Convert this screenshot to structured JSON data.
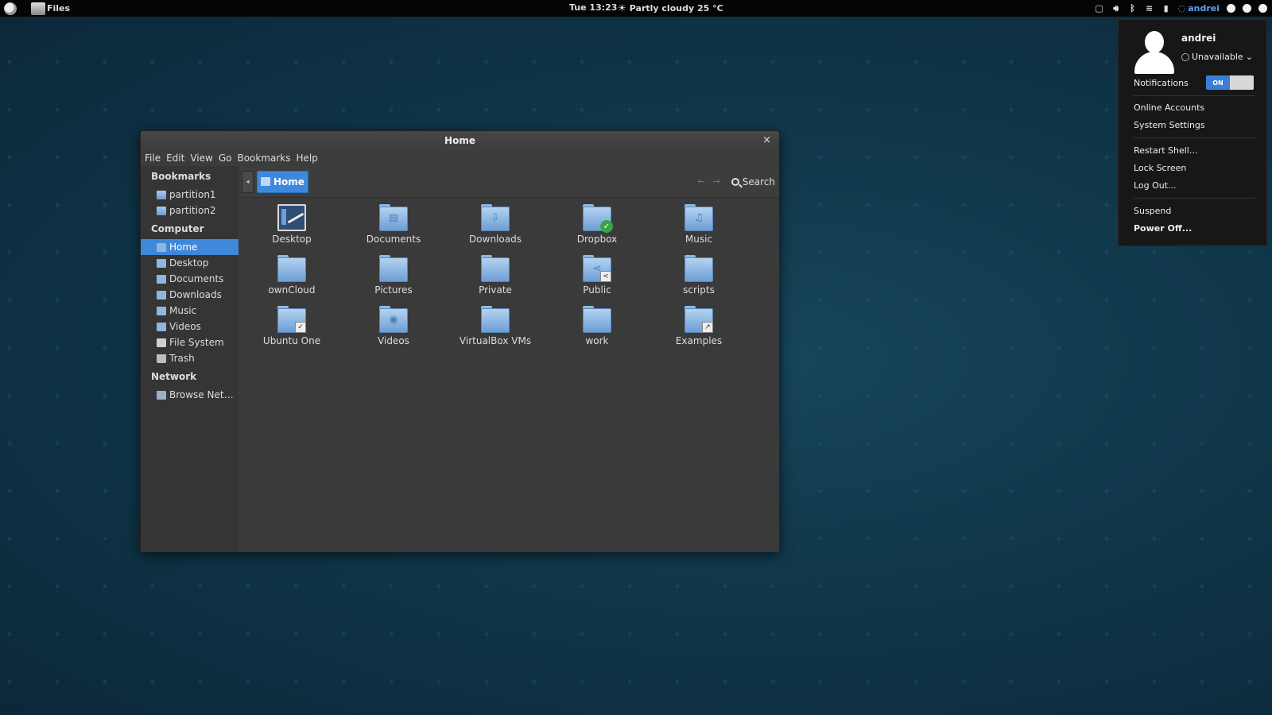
{
  "top_panel": {
    "app_name": "Files",
    "clock": "Tue 13:23",
    "weather": "Partly cloudy 25 °C",
    "user": "andrei"
  },
  "user_menu": {
    "name": "andrei",
    "status": "Unavailable",
    "notifications_label": "Notifications",
    "notifications_toggle": "ON",
    "items": {
      "online_accounts": "Online Accounts",
      "system_settings": "System Settings",
      "restart_shell": "Restart Shell...",
      "lock_screen": "Lock Screen",
      "log_out": "Log Out...",
      "suspend": "Suspend",
      "power_off": "Power Off..."
    }
  },
  "window": {
    "title": "Home",
    "close_glyph": "×",
    "menu": [
      "File",
      "Edit",
      "View",
      "Go",
      "Bookmarks",
      "Help"
    ],
    "sidebar": {
      "bookmarks_header": "Bookmarks",
      "bookmarks": [
        "partition1",
        "partition2"
      ],
      "computer_header": "Computer",
      "computer": [
        "Home",
        "Desktop",
        "Documents",
        "Downloads",
        "Music",
        "Videos",
        "File System",
        "Trash"
      ],
      "network_header": "Network",
      "network": [
        "Browse Net…"
      ]
    },
    "breadcrumb": "Home",
    "search_label": "Search",
    "files": [
      "Desktop",
      "Documents",
      "Downloads",
      "Dropbox",
      "Music",
      "ownCloud",
      "Pictures",
      "Private",
      "Public",
      "scripts",
      "Ubuntu One",
      "Videos",
      "VirtualBox VMs",
      "work",
      "Examples"
    ]
  },
  "colors": {
    "accent": "#3f87d9",
    "panel": "#050505",
    "desktop": "#0f3447"
  }
}
